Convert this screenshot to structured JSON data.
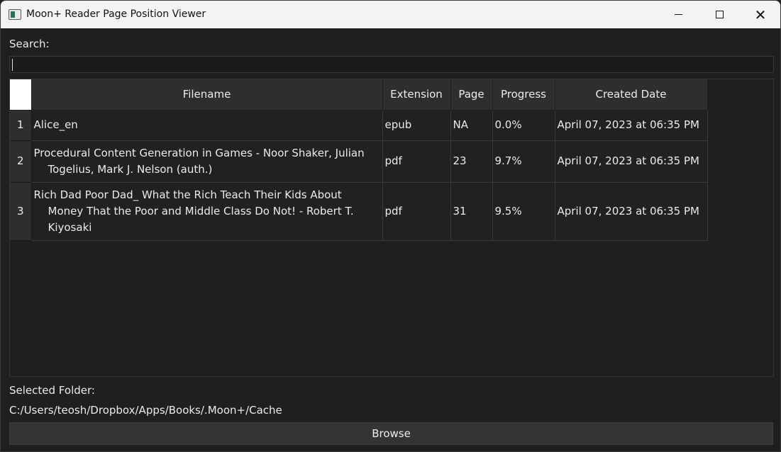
{
  "window": {
    "title": "Moon+ Reader Page Position Viewer",
    "controls": [
      "minimize",
      "maximize",
      "close"
    ]
  },
  "search": {
    "label": "Search:",
    "value": "",
    "placeholder": ""
  },
  "table": {
    "columns": [
      "Filename",
      "Extension",
      "Page",
      "Progress",
      "Created Date"
    ],
    "rows": [
      {
        "index": "1",
        "filename": "Alice_en",
        "extension": "epub",
        "page": "NA",
        "progress": "0.0%",
        "created": "April 07, 2023 at 06:35 PM"
      },
      {
        "index": "2",
        "filename": "Procedural Content Generation in Games - Noor Shaker, Julian Togelius, Mark J. Nelson (auth.)",
        "extension": "pdf",
        "page": "23",
        "progress": "9.7%",
        "created": "April 07, 2023 at 06:35 PM"
      },
      {
        "index": "3",
        "filename": "Rich Dad Poor Dad_ What the Rich Teach Their Kids About Money That the Poor and Middle Class Do Not! - Robert T. Kiyosaki",
        "extension": "pdf",
        "page": "31",
        "progress": "9.5%",
        "created": "April 07, 2023 at 06:35 PM"
      }
    ]
  },
  "folder": {
    "label": "Selected Folder:",
    "path": "C:/Users/teosh/Dropbox/Apps/Books/.Moon+/Cache"
  },
  "browse_label": "Browse",
  "colors": {
    "background": "#1f1f1f",
    "titlebar": "#f3f3f3",
    "header_cell": "#2e2e2e",
    "text": "#ebebeb"
  }
}
